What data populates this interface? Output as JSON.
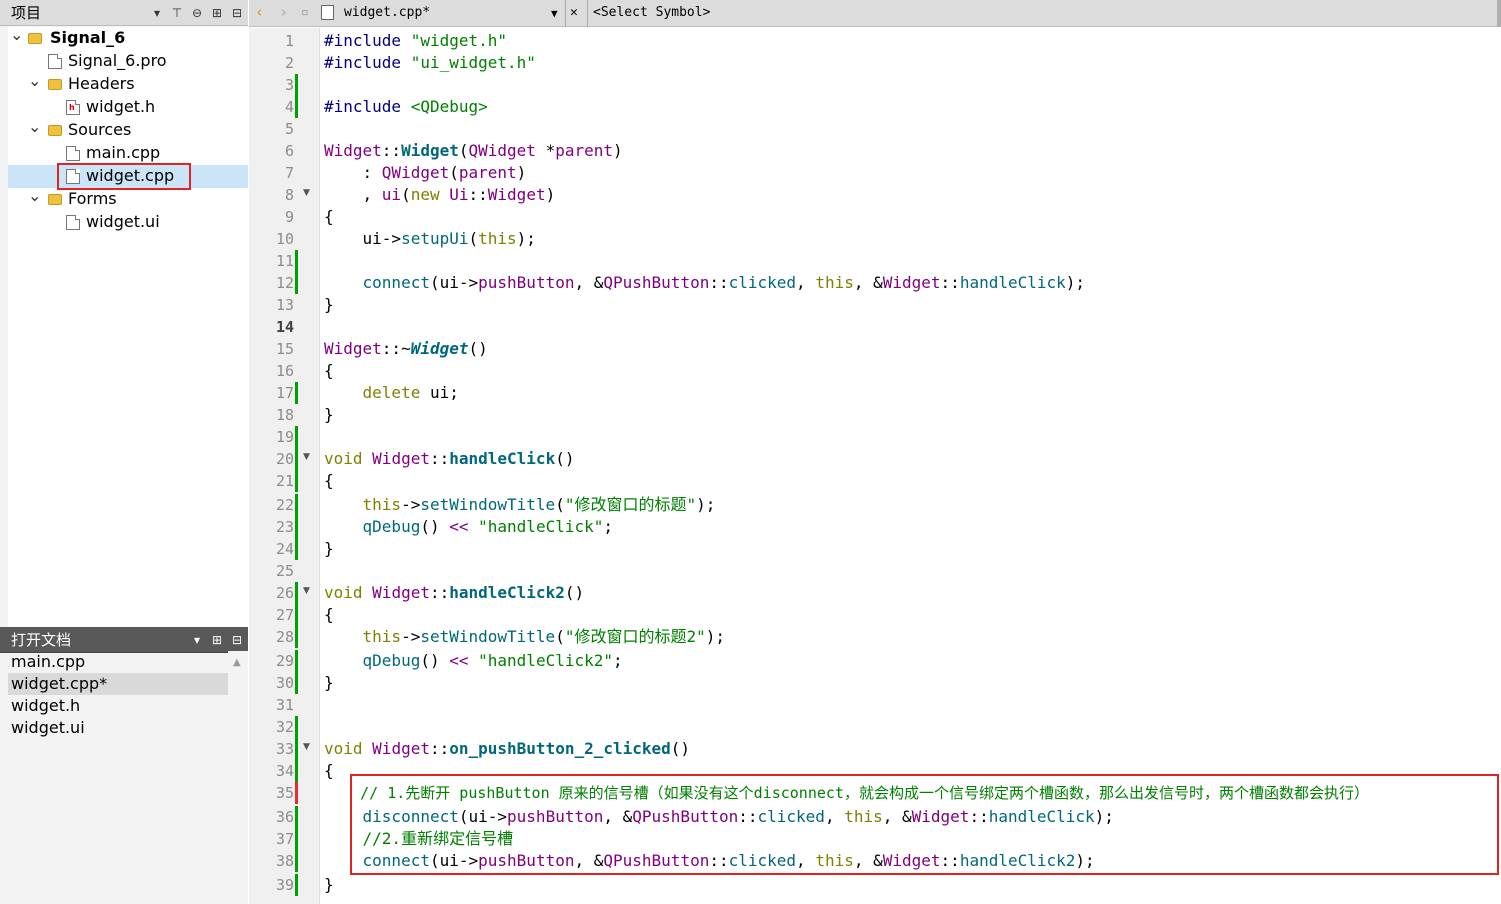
{
  "project_panel": {
    "title": "项目",
    "tree": [
      {
        "label": "Signal_6",
        "icon": "project-folder-icon",
        "bold": true
      },
      {
        "label": "Signal_6.pro",
        "icon": "pro-file-icon"
      },
      {
        "label": "Headers",
        "icon": "headers-folder-icon"
      },
      {
        "label": "widget.h",
        "icon": "header-file-icon"
      },
      {
        "label": "Sources",
        "icon": "sources-folder-icon"
      },
      {
        "label": "main.cpp",
        "icon": "cpp-file-icon"
      },
      {
        "label": "widget.cpp",
        "icon": "cpp-file-icon",
        "selected": true
      },
      {
        "label": "Forms",
        "icon": "forms-folder-icon"
      },
      {
        "label": "widget.ui",
        "icon": "ui-file-icon"
      }
    ]
  },
  "open_docs": {
    "title": "打开文档",
    "items": [
      "main.cpp",
      "widget.cpp*",
      "widget.h",
      "widget.ui"
    ],
    "active_index": 1
  },
  "editor": {
    "file_tab": "widget.cpp*",
    "symbol_selector": "<Select Symbol>",
    "current_line": 14,
    "lines": [
      "#include \"widget.h\"",
      "#include \"ui_widget.h\"",
      "",
      "#include <QDebug>",
      "",
      "Widget::Widget(QWidget *parent)",
      "    : QWidget(parent)",
      "    , ui(new Ui::Widget)",
      "{",
      "    ui->setupUi(this);",
      "",
      "    connect(ui->pushButton, &QPushButton::clicked, this, &Widget::handleClick);",
      "}",
      "",
      "Widget::~Widget()",
      "{",
      "    delete ui;",
      "}",
      "",
      "void Widget::handleClick()",
      "{",
      "    this->setWindowTitle(\"修改窗口的标题\");",
      "    qDebug() << \"handleClick\";",
      "}",
      "",
      "void Widget::handleClick2()",
      "{",
      "    this->setWindowTitle(\"修改窗口的标题2\");",
      "    qDebug() << \"handleClick2\";",
      "}",
      "",
      "",
      "void Widget::on_pushButton_2_clicked()",
      "{",
      "    // 1.先断开 pushButton 原来的信号槽（如果没有这个disconnect，就会构成一个信号绑定两个槽函数，那么出发信号时，两个槽函数都会执行）",
      "    disconnect(ui->pushButton, &QPushButton::clicked, this, &Widget::handleClick);",
      "    //2.重新绑定信号槽",
      "    connect(ui->pushButton, &QPushButton::clicked, this, &Widget::handleClick2);",
      "}"
    ]
  },
  "colors": {
    "keyword": "#808000",
    "string": "#008000",
    "type": "#800080",
    "function": "#00677c",
    "highlight_box": "#e02424",
    "modified_marker": "#00a000"
  }
}
